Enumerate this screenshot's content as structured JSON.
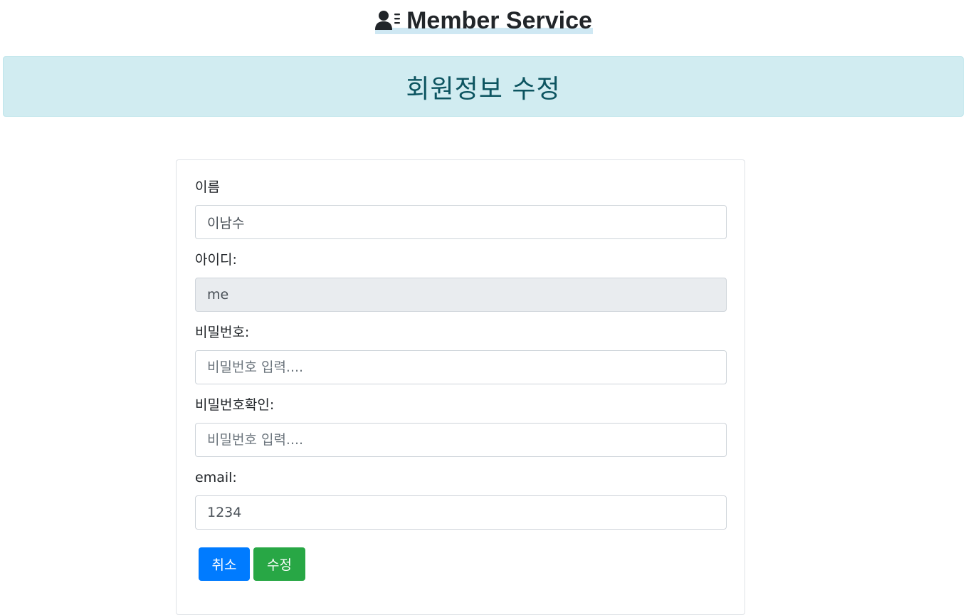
{
  "header": {
    "brand_title": "Member Service",
    "brand_icon": "user-list-icon"
  },
  "banner": {
    "title": "회원정보 수정"
  },
  "form": {
    "name": {
      "label": "이름",
      "value": "이남수"
    },
    "userid": {
      "label": "아이디:",
      "value": "me"
    },
    "password": {
      "label": "비밀번호:",
      "placeholder": "비밀번호 입력...."
    },
    "password_confirm": {
      "label": "비밀번호확인:",
      "placeholder": "비밀번호 입력...."
    },
    "email": {
      "label": "email:",
      "value": "1234"
    }
  },
  "buttons": {
    "cancel_label": "취소",
    "submit_label": "수정"
  },
  "colors": {
    "banner_bg": "#d1ecf1",
    "banner_text": "#0c5460",
    "cancel_button": "#007bff",
    "submit_button": "#28a745",
    "readonly_bg": "#e9ecef"
  }
}
